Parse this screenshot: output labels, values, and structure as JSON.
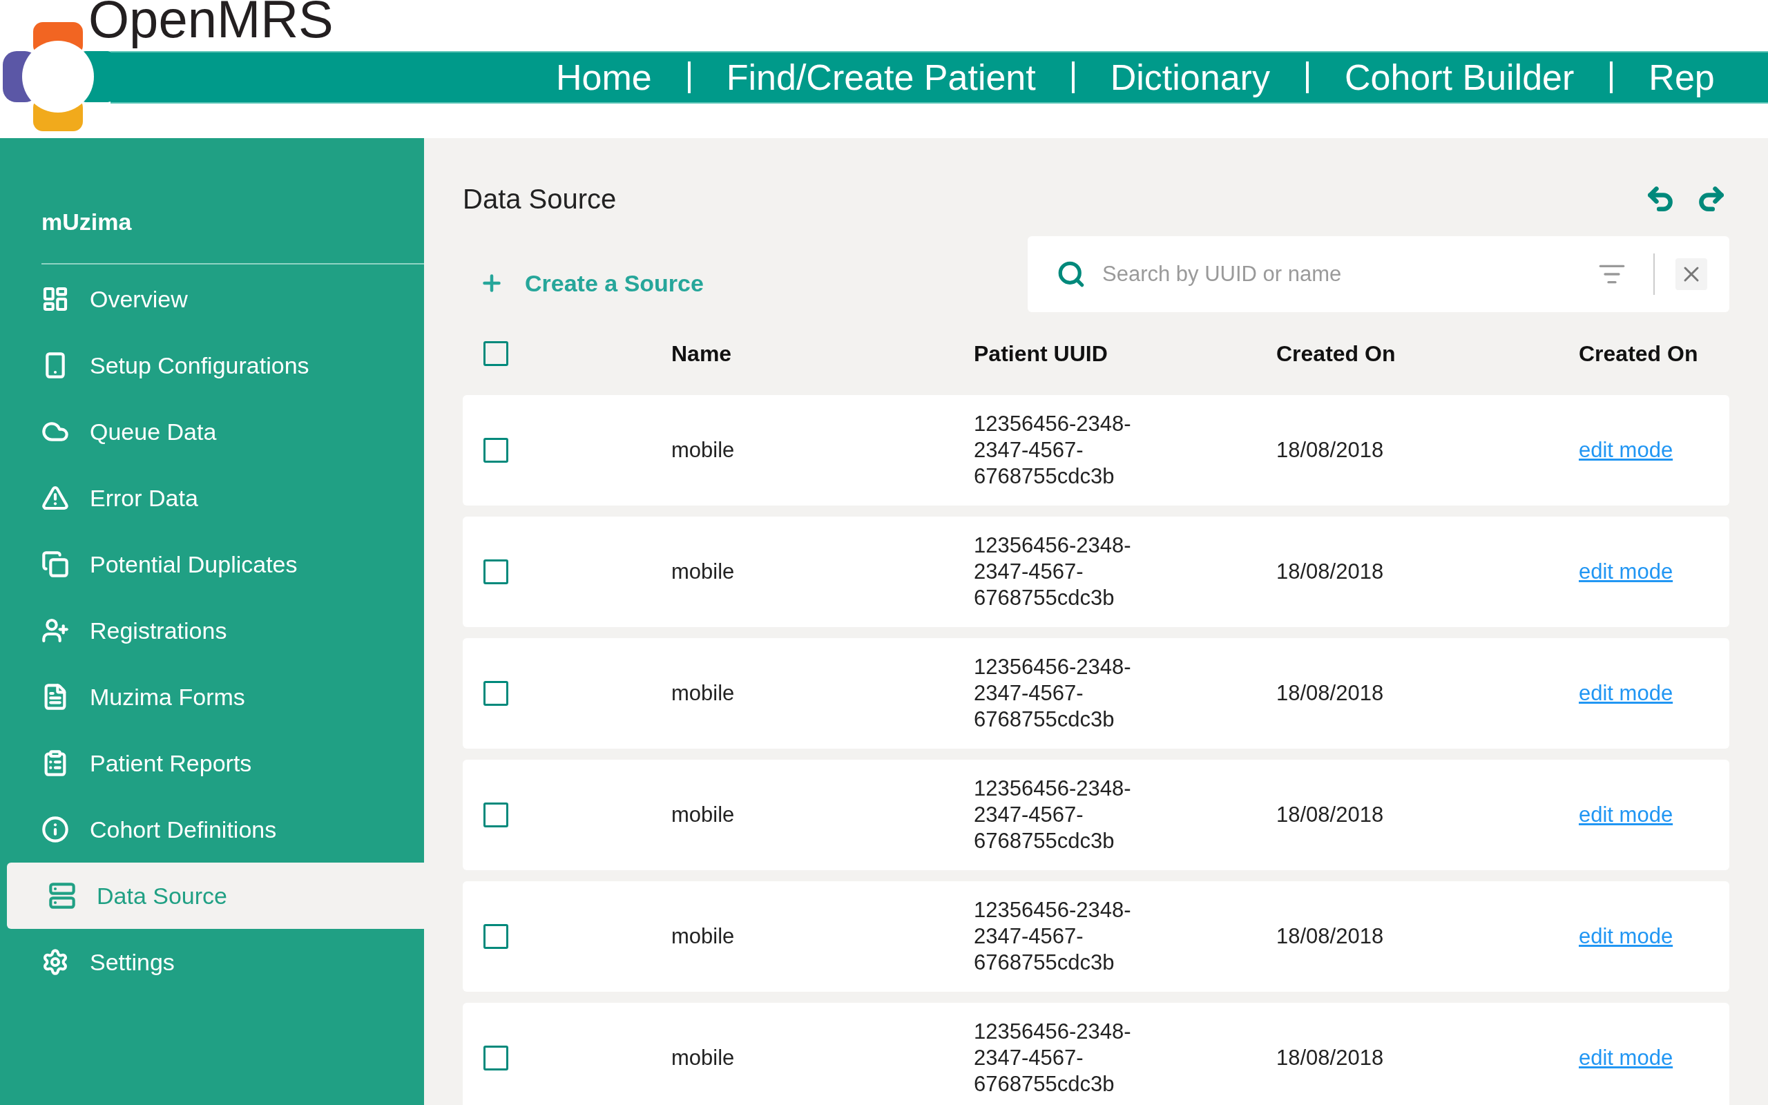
{
  "header": {
    "brand": "OpenMRS",
    "nav": [
      {
        "label": "Home"
      },
      {
        "label": "Find/Create Patient"
      },
      {
        "label": "Dictionary"
      },
      {
        "label": "Cohort Builder"
      },
      {
        "label": "Rep"
      }
    ]
  },
  "sidebar": {
    "title": "mUzima",
    "items": [
      {
        "label": "Overview",
        "selected": false
      },
      {
        "label": "Setup Configurations",
        "selected": false
      },
      {
        "label": "Queue Data",
        "selected": false
      },
      {
        "label": "Error Data",
        "selected": false
      },
      {
        "label": "Potential Duplicates",
        "selected": false
      },
      {
        "label": "Registrations",
        "selected": false
      },
      {
        "label": "Muzima Forms",
        "selected": false
      },
      {
        "label": "Patient Reports",
        "selected": false
      },
      {
        "label": "Cohort Definitions",
        "selected": false
      },
      {
        "label": "Data Source",
        "selected": true
      },
      {
        "label": "Settings",
        "selected": false
      }
    ]
  },
  "page": {
    "title": "Data Source",
    "create_button": "Create a Source",
    "search": {
      "placeholder": "Search by UUID or name"
    }
  },
  "table": {
    "select_all_checked": false,
    "columns": [
      "Name",
      "Patient UUID",
      "Created On",
      "Created On"
    ],
    "rows": [
      {
        "checked": false,
        "name": "mobile",
        "uuid": "12356456-2348-2347-4567-6768755cdc3b",
        "created": "18/08/2018",
        "action": "edit mode"
      },
      {
        "checked": false,
        "name": "mobile",
        "uuid": "12356456-2348-2347-4567-6768755cdc3b",
        "created": "18/08/2018",
        "action": "edit mode"
      },
      {
        "checked": false,
        "name": "mobile",
        "uuid": "12356456-2348-2347-4567-6768755cdc3b",
        "created": "18/08/2018",
        "action": "edit mode"
      },
      {
        "checked": false,
        "name": "mobile",
        "uuid": "12356456-2348-2347-4567-6768755cdc3b",
        "created": "18/08/2018",
        "action": "edit mode"
      },
      {
        "checked": false,
        "name": "mobile",
        "uuid": "12356456-2348-2347-4567-6768755cdc3b",
        "created": "18/08/2018",
        "action": "edit mode"
      },
      {
        "checked": false,
        "name": "mobile",
        "uuid": "12356456-2348-2347-4567-6768755cdc3b",
        "created": "18/08/2018",
        "action": "edit mode"
      }
    ]
  }
}
